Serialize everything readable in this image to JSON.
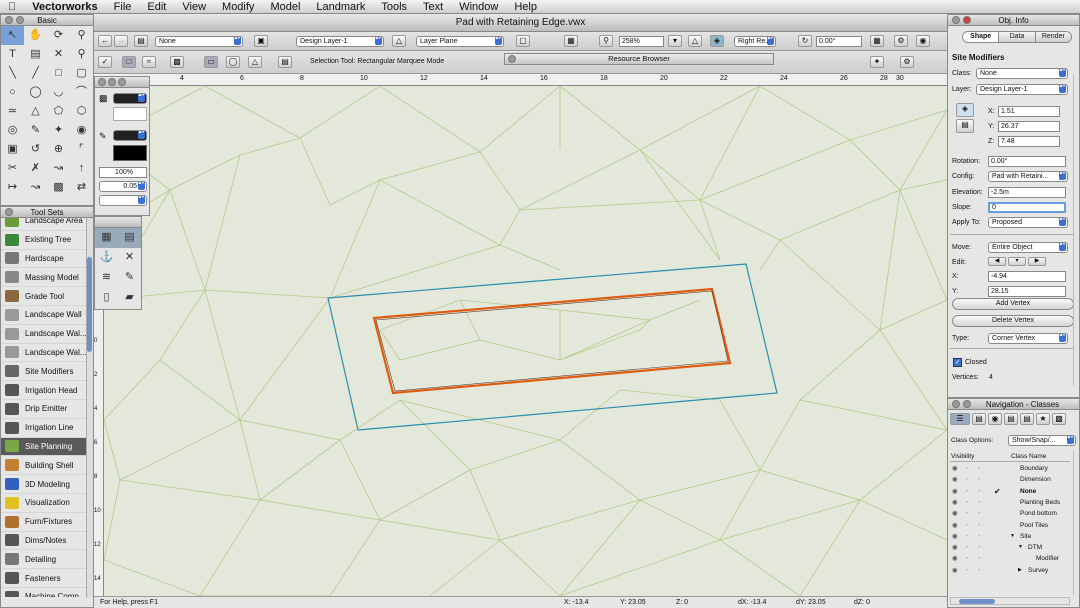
{
  "menubar": {
    "app": "Vectorworks",
    "items": [
      "File",
      "Edit",
      "View",
      "Modify",
      "Model",
      "Landmark",
      "Tools",
      "Text",
      "Window",
      "Help"
    ]
  },
  "window": {
    "title": "Pad with Retaining Edge.vwx"
  },
  "toolbar": {
    "class": "None",
    "layer": "Design Layer-1",
    "plane": "Layer Plane",
    "zoom": "258%",
    "view": "Right Re...",
    "angle": "0.00°"
  },
  "mode_bar": {
    "status": "Selection Tool: Rectangular Marquee Mode",
    "resource_browser": "Resource Browser"
  },
  "basic_palette": {
    "title": "Basic"
  },
  "attrs_palette": {
    "opacity": "100%",
    "line_weight": "0.05"
  },
  "tool_sets": {
    "title": "Tool Sets",
    "items": [
      {
        "label": "Landscape Area",
        "color": "#6a9c3a"
      },
      {
        "label": "Existing Tree",
        "color": "#3a8a3a"
      },
      {
        "label": "Hardscape",
        "color": "#777"
      },
      {
        "label": "Massing Model",
        "color": "#888"
      },
      {
        "label": "Grade Tool",
        "color": "#8a6a3a"
      },
      {
        "label": "Landscape Wall",
        "color": "#999"
      },
      {
        "label": "Landscape Wal...",
        "color": "#999"
      },
      {
        "label": "Landscape Wal...",
        "color": "#999"
      },
      {
        "label": "Site Modifiers",
        "color": "#666"
      },
      {
        "label": "Irrigation Head",
        "color": "#555"
      },
      {
        "label": "Drip Emitter",
        "color": "#555"
      },
      {
        "label": "Irrigation Line",
        "color": "#555"
      },
      {
        "label": "Site Planning",
        "color": "#7aa844",
        "active": true
      },
      {
        "label": "Building Shell",
        "color": "#c08030"
      },
      {
        "label": "3D Modeling",
        "color": "#3060c0"
      },
      {
        "label": "Visualization",
        "color": "#e0c020"
      },
      {
        "label": "Furn/Fixtures",
        "color": "#b07030"
      },
      {
        "label": "Dims/Notes",
        "color": "#555"
      },
      {
        "label": "Detailing",
        "color": "#777"
      },
      {
        "label": "Fasteners",
        "color": "#555"
      },
      {
        "label": "Machine Comp...",
        "color": "#555"
      }
    ]
  },
  "ruler": {
    "top": [
      "4",
      "6",
      "8",
      "10",
      "12",
      "14",
      "16",
      "18",
      "20",
      "22",
      "24",
      "26",
      "28",
      "30"
    ],
    "left": [
      "14",
      "12",
      "10",
      "8",
      "6",
      "4",
      "2",
      "0",
      "2",
      "4",
      "6",
      "8",
      "10",
      "12",
      "14"
    ]
  },
  "status_bar": {
    "help": "For Help, press F1",
    "x": "X: -13.4",
    "y": "Y: 23.05",
    "z": "Z: 0",
    "dx": "dX: -13.4",
    "dy": "dY: 23.05",
    "dz": "dZ: 0"
  },
  "obj_info": {
    "title": "Obj. Info",
    "tabs": [
      "Shape",
      "Data",
      "Render"
    ],
    "object_type": "Site Modifiers",
    "class_label": "Class:",
    "class": "None",
    "layer_label": "Layer:",
    "layer": "Design Layer-1",
    "x_label": "X:",
    "x": "1.51",
    "y_label": "Y:",
    "y": "26.37",
    "z_label": "Z:",
    "z": "7.48",
    "rotation_label": "Rotation:",
    "rotation": "0.00°",
    "config_label": "Config:",
    "config": "Pad with Retaini...",
    "elevation_label": "Elevation:",
    "elevation": "-2.5m",
    "slope_label": "Slope:",
    "slope": "0",
    "apply_label": "Apply To:",
    "apply": "Proposed",
    "move_label": "Move:",
    "move": "Entire Object",
    "edit_label": "Edit:",
    "vx_label": "X:",
    "vx": "-4.94",
    "vy_label": "Y:",
    "vy": "28.15",
    "add_vertex": "Add Vertex",
    "delete_vertex": "Delete Vertex",
    "type_label": "Type:",
    "type": "Corner Vertex",
    "closed": "Closed",
    "vertices_label": "Vertices:",
    "vertices": "4"
  },
  "navigation": {
    "title": "Navigation - Classes",
    "class_options_label": "Class Options:",
    "class_options": "Show/Snap/...",
    "col_visibility": "Visibility",
    "col_name": "Class Name",
    "rows": [
      "Boundary",
      "Dimension",
      "None",
      "Planting Beds",
      "Pond bottom",
      "Pool Tiles",
      "Site",
      "DTM",
      "Modifier",
      "Survey"
    ]
  },
  "colors": {
    "pad_inner": "#e05a10",
    "pad_outer": "#2a8fb0",
    "mesh": "#b8c98a",
    "background": "#e3e8da"
  }
}
